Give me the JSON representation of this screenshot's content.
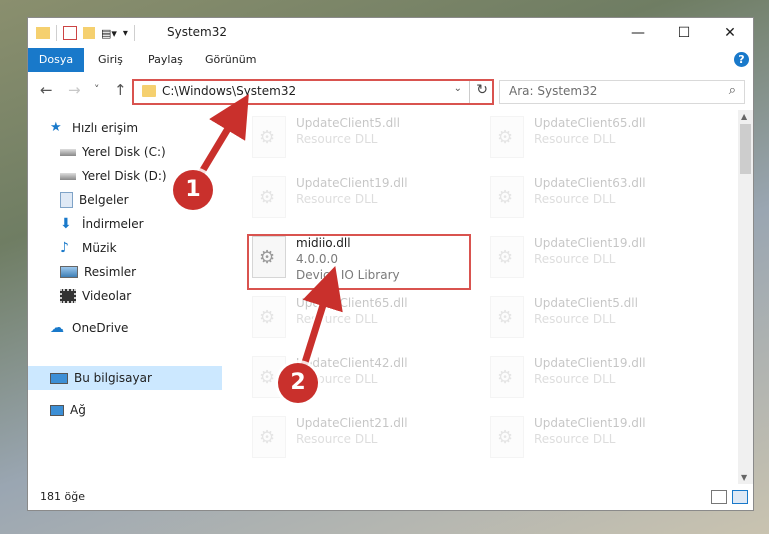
{
  "window": {
    "title": "System32",
    "controls": {
      "minimize": "—",
      "maximize": "☐",
      "close": "✕"
    }
  },
  "ribbon": {
    "tabs": [
      "Dosya",
      "Giriş",
      "Paylaş",
      "Görünüm"
    ],
    "help": "?"
  },
  "nav": {
    "back": "←",
    "forward": "→",
    "recent": "˅",
    "up": "↑",
    "address": "C:\\Windows\\System32",
    "address_dropdown": "⌄",
    "refresh": "↻",
    "search_placeholder": "Ara: System32",
    "search_icon": "⌕"
  },
  "sidebar": {
    "items": [
      {
        "label": "Hızlı erişim",
        "icon": "star-icon",
        "pinned": false
      },
      {
        "label": "Yerel Disk (C:)",
        "icon": "drive-icon",
        "pinned": false
      },
      {
        "label": "Yerel Disk (D:)",
        "icon": "drive-icon",
        "pinned": false
      },
      {
        "label": "Belgeler",
        "icon": "document-icon",
        "pinned": true
      },
      {
        "label": "İndirmeler",
        "icon": "download-icon",
        "pinned": true
      },
      {
        "label": "Müzik",
        "icon": "music-icon",
        "pinned": true
      },
      {
        "label": "Resimler",
        "icon": "pictures-icon",
        "pinned": true
      },
      {
        "label": "Videolar",
        "icon": "video-icon",
        "pinned": true
      },
      {
        "label": "OneDrive",
        "icon": "cloud-icon",
        "pinned": false
      },
      {
        "label": "Bu bilgisayar",
        "icon": "computer-icon",
        "pinned": false,
        "selected": true
      },
      {
        "label": "Ağ",
        "icon": "network-icon",
        "pinned": false
      }
    ],
    "pin_glyph": "📌"
  },
  "files": {
    "left_column": [
      {
        "name": "UpdateClient5.dll",
        "desc": "Resource DLL"
      },
      {
        "name": "UpdateClient19.dll",
        "desc": "Resource DLL"
      },
      {
        "name": "UpdateClient65.dll",
        "desc": "Resource DLL"
      },
      {
        "name": "UpdateClient42.dll",
        "desc": "Resource DLL"
      },
      {
        "name": "UpdateClient21.dll",
        "desc": "Resource DLL"
      }
    ],
    "right_column": [
      {
        "name": "UpdateClient65.dll",
        "desc": "Resource DLL"
      },
      {
        "name": "UpdateClient63.dll",
        "desc": "Resource DLL"
      },
      {
        "name": "UpdateClient19.dll",
        "desc": "Resource DLL"
      },
      {
        "name": "UpdateClient5.dll",
        "desc": "Resource DLL"
      },
      {
        "name": "UpdateClient19.dll",
        "desc": "Resource DLL"
      },
      {
        "name": "UpdateClient19.dll",
        "desc": "Resource DLL"
      }
    ],
    "highlighted": {
      "name": "midiio.dll",
      "version": "4.0.0.0",
      "desc": "Device IO Library"
    }
  },
  "status": {
    "count": "181 öğe"
  },
  "callouts": [
    "1",
    "2"
  ],
  "colors": {
    "accent": "#1979ca",
    "callout": "#c9302c",
    "highlight_border": "#d9534f"
  }
}
